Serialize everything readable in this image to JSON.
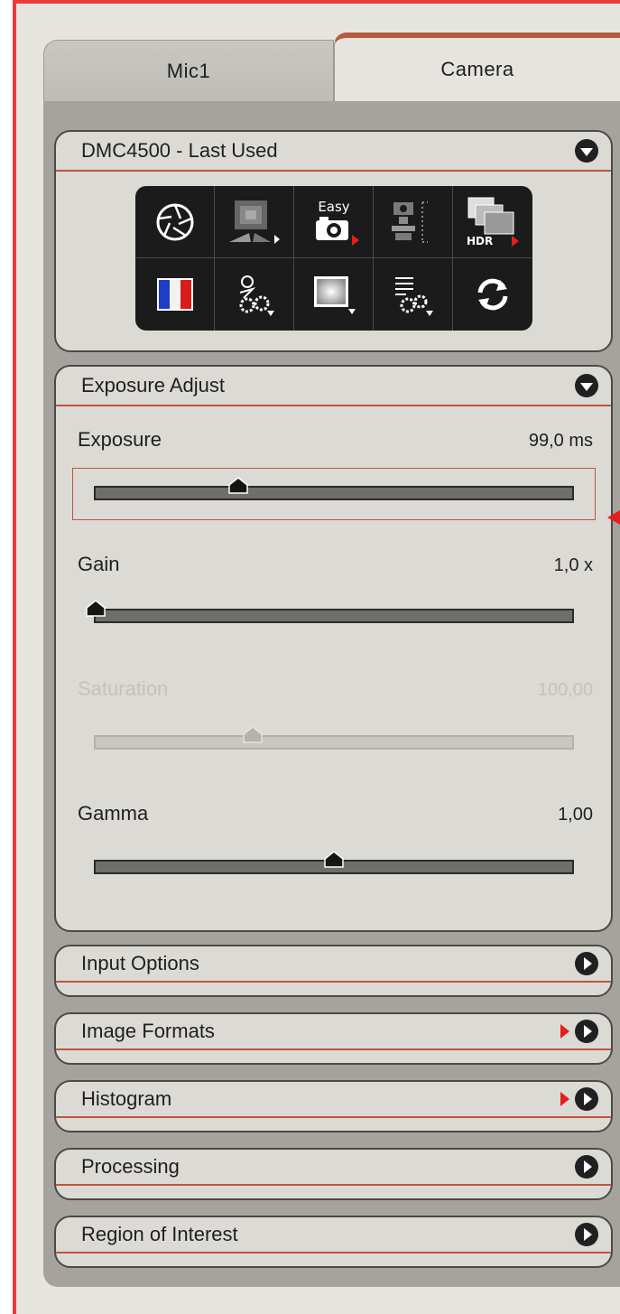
{
  "tabs": [
    {
      "label": "Mic1",
      "active": false
    },
    {
      "label": "Camera",
      "active": true
    }
  ],
  "camera_section": {
    "title": "DMC4500 - Last Used",
    "tools": [
      {
        "icon": "aperture-icon"
      },
      {
        "icon": "exposure-mode-icon"
      },
      {
        "icon": "easy-camera-icon",
        "label": "Easy"
      },
      {
        "icon": "microscope-icon"
      },
      {
        "icon": "hdr-icon",
        "label": "HDR"
      },
      {
        "icon": "color-balance-icon"
      },
      {
        "icon": "settings-gear-icon"
      },
      {
        "icon": "shading-icon"
      },
      {
        "icon": "list-settings-icon"
      },
      {
        "icon": "refresh-icon"
      }
    ]
  },
  "exposure_section": {
    "title": "Exposure Adjust",
    "params": [
      {
        "label": "Exposure",
        "value": "99,0 ms",
        "level": 0.3,
        "enabled": true
      },
      {
        "label": "Gain",
        "value": "1,0 x",
        "level": 0.0,
        "enabled": true
      },
      {
        "label": "Saturation",
        "value": "100,00",
        "level": 0.33,
        "enabled": false
      },
      {
        "label": "Gamma",
        "value": "1,00",
        "level": 0.5,
        "enabled": true
      }
    ]
  },
  "collapsed_sections": [
    {
      "title": "Input Options",
      "marker": false
    },
    {
      "title": "Image Formats",
      "marker": true
    },
    {
      "title": "Histogram",
      "marker": true
    },
    {
      "title": "Processing",
      "marker": false
    },
    {
      "title": "Region of Interest",
      "marker": false
    }
  ],
  "colors": {
    "accent": "#c2553a",
    "highlight_arrow": "#e41e1e",
    "frame": "#ee3a3a"
  }
}
